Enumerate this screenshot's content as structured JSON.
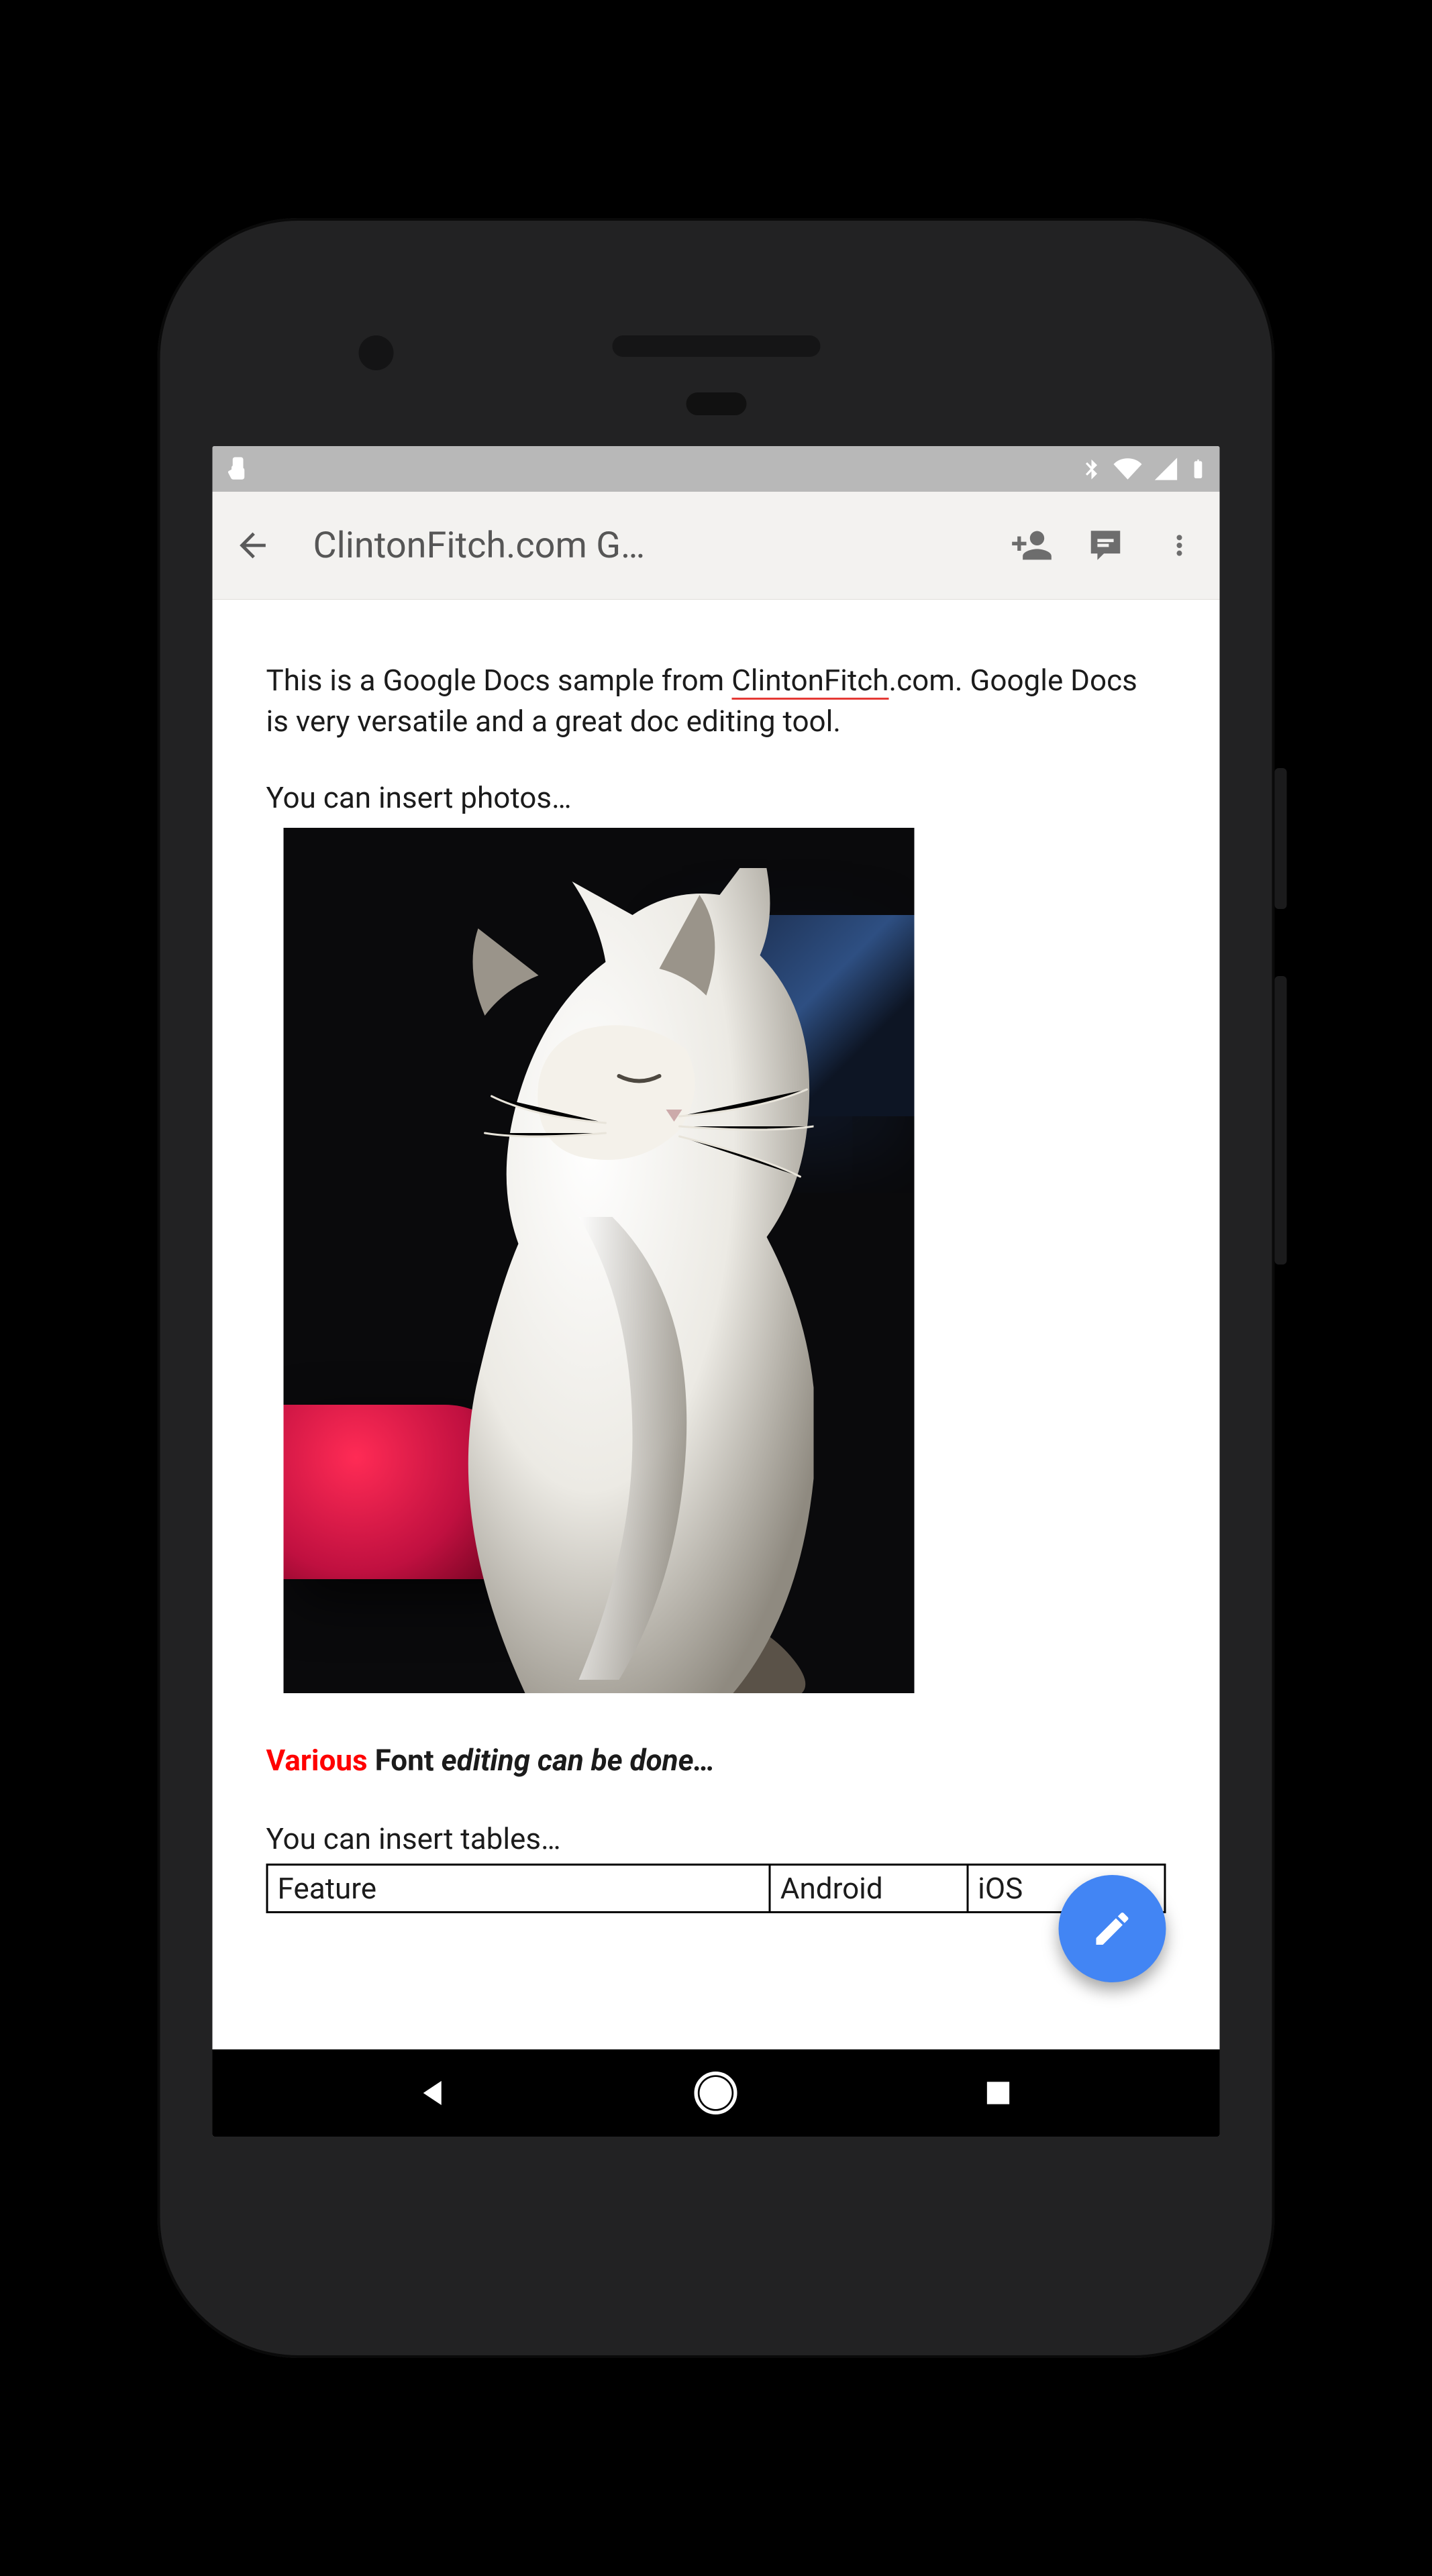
{
  "statusbar": {
    "icons_left": [
      "swipe-indicator-icon"
    ],
    "icons_right": [
      "bluetooth-icon",
      "wifi-icon",
      "cell-signal-icon",
      "battery-icon"
    ]
  },
  "appbar": {
    "title": "ClintonFitch.com G…",
    "actions": {
      "back": "back-icon",
      "add_person": "add-person-icon",
      "comment": "comment-icon",
      "overflow": "overflow-icon"
    }
  },
  "document": {
    "paragraph1_a": "This is a Google Docs sample from ",
    "paragraph1_link": "ClintonFitch",
    "paragraph1_b": ".com.  Google Docs is very versatile and a great doc editing tool.",
    "paragraph2": "You can insert photos…",
    "image_alt": "Photo of a white cat sitting, lit from the left, dark room background with red fabric and a TV screen",
    "formatted_line": {
      "various": "Various",
      "font": " Font ",
      "rest": "editing can be done…"
    },
    "paragraph3": "You can insert tables…",
    "table": {
      "headers": [
        "Feature",
        "Android",
        "iOS"
      ]
    }
  },
  "fab": {
    "icon": "pencil-icon"
  },
  "navbar": {
    "buttons": [
      "nav-back-icon",
      "nav-home-icon",
      "nav-recent-icon"
    ]
  },
  "colors": {
    "accent": "#4285f4",
    "danger": "#ff0000"
  }
}
